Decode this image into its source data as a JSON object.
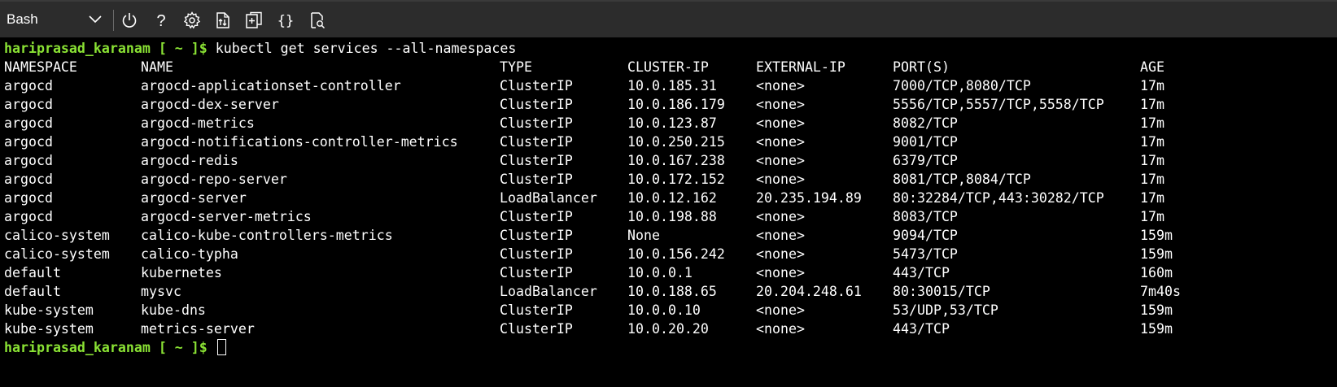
{
  "toolbar": {
    "shell": "Bash",
    "icons": [
      "chevron-down-icon",
      "power-icon",
      "help-icon",
      "gear-icon",
      "upload-download-icon",
      "open-editor-icon",
      "braces-icon",
      "preview-icon"
    ],
    "help_glyph": "?",
    "braces_glyph": "{}"
  },
  "terminal": {
    "prompt": "hariprasad_karanam [ ~ ]$",
    "command": " kubectl get services --all-namespaces",
    "headers": [
      "NAMESPACE",
      "NAME",
      "TYPE",
      "CLUSTER-IP",
      "EXTERNAL-IP",
      "PORT(S)",
      "AGE"
    ],
    "rows": [
      [
        "argocd",
        "argocd-applicationset-controller",
        "ClusterIP",
        "10.0.185.31",
        "<none>",
        "7000/TCP,8080/TCP",
        "17m"
      ],
      [
        "argocd",
        "argocd-dex-server",
        "ClusterIP",
        "10.0.186.179",
        "<none>",
        "5556/TCP,5557/TCP,5558/TCP",
        "17m"
      ],
      [
        "argocd",
        "argocd-metrics",
        "ClusterIP",
        "10.0.123.87",
        "<none>",
        "8082/TCP",
        "17m"
      ],
      [
        "argocd",
        "argocd-notifications-controller-metrics",
        "ClusterIP",
        "10.0.250.215",
        "<none>",
        "9001/TCP",
        "17m"
      ],
      [
        "argocd",
        "argocd-redis",
        "ClusterIP",
        "10.0.167.238",
        "<none>",
        "6379/TCP",
        "17m"
      ],
      [
        "argocd",
        "argocd-repo-server",
        "ClusterIP",
        "10.0.172.152",
        "<none>",
        "8081/TCP,8084/TCP",
        "17m"
      ],
      [
        "argocd",
        "argocd-server",
        "LoadBalancer",
        "10.0.12.162",
        "20.235.194.89",
        "80:32284/TCP,443:30282/TCP",
        "17m"
      ],
      [
        "argocd",
        "argocd-server-metrics",
        "ClusterIP",
        "10.0.198.88",
        "<none>",
        "8083/TCP",
        "17m"
      ],
      [
        "calico-system",
        "calico-kube-controllers-metrics",
        "ClusterIP",
        "None",
        "<none>",
        "9094/TCP",
        "159m"
      ],
      [
        "calico-system",
        "calico-typha",
        "ClusterIP",
        "10.0.156.242",
        "<none>",
        "5473/TCP",
        "159m"
      ],
      [
        "default",
        "kubernetes",
        "ClusterIP",
        "10.0.0.1",
        "<none>",
        "443/TCP",
        "160m"
      ],
      [
        "default",
        "mysvc",
        "LoadBalancer",
        "10.0.188.65",
        "20.204.248.61",
        "80:30015/TCP",
        "7m40s"
      ],
      [
        "kube-system",
        "kube-dns",
        "ClusterIP",
        "10.0.0.10",
        "<none>",
        "53/UDP,53/TCP",
        "159m"
      ],
      [
        "kube-system",
        "metrics-server",
        "ClusterIP",
        "10.0.20.20",
        "<none>",
        "443/TCP",
        "159m"
      ]
    ],
    "final_prompt": "hariprasad_karanam [ ~ ]$"
  },
  "colors": {
    "toolbar_bg": "#2c2c2c",
    "terminal_bg": "#000000",
    "prompt_green": "#8ae234",
    "text": "#ffffff"
  }
}
